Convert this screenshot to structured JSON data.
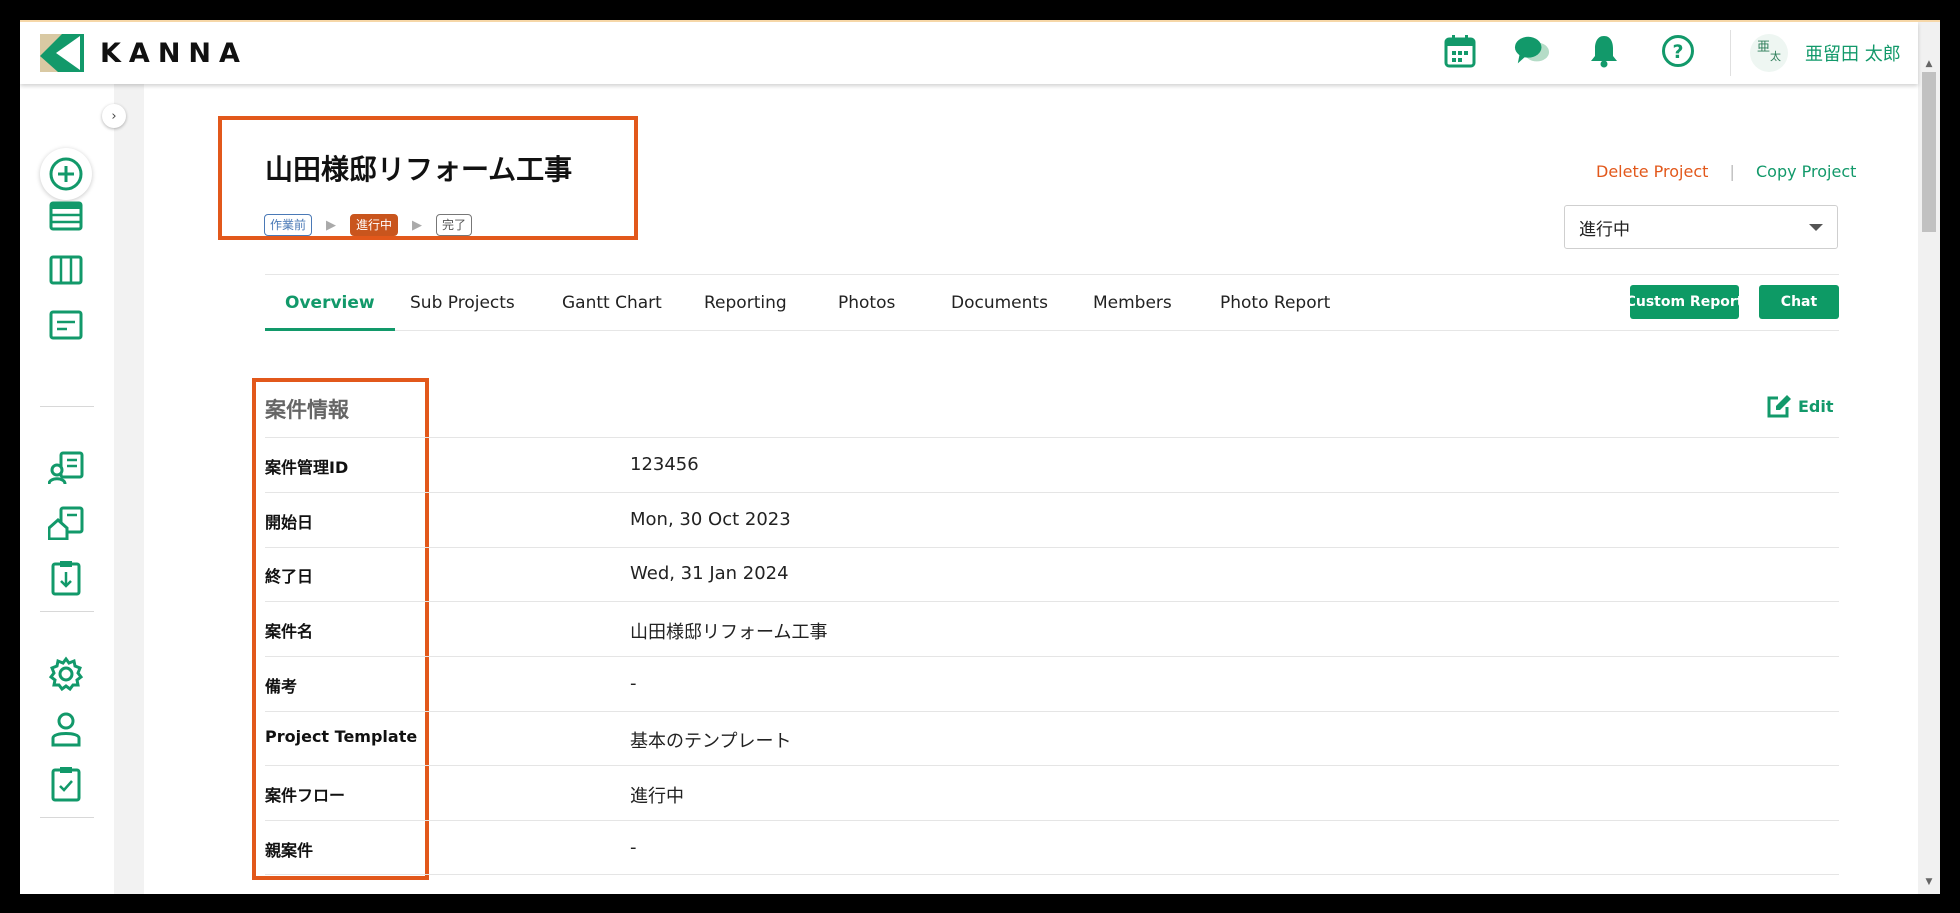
{
  "app": {
    "logo_text": "KANNA",
    "brand_color": "#12996a",
    "accent_color": "#e2581b"
  },
  "header": {
    "icons": [
      "calendar-icon",
      "chat-bubbles-icon",
      "bell-icon",
      "help-icon"
    ],
    "avatar_text_top": "亜",
    "avatar_text_bottom": "太",
    "user_name": "亜留田 太郎"
  },
  "sidebar": {
    "collapse_glyph": "›",
    "items": [
      "add-icon",
      "list-icon",
      "board-icon",
      "card-icon",
      "client-icon",
      "property-icon",
      "clipboard-download-icon",
      "gear-icon",
      "user-icon",
      "clipboard-check-icon"
    ]
  },
  "project": {
    "title": "山田様邸リフォーム工事",
    "flow": [
      {
        "label": "作業前",
        "state": "pre"
      },
      {
        "label": "進行中",
        "state": "current"
      },
      {
        "label": "完了",
        "state": "done"
      }
    ],
    "delete_label": "Delete Project",
    "copy_label": "Copy Project",
    "separator": "|",
    "status_value": "進行中"
  },
  "tabs": [
    "Overview",
    "Sub Projects",
    "Gantt Chart",
    "Reporting",
    "Photos",
    "Documents",
    "Members",
    "Photo Report"
  ],
  "active_tab": "Overview",
  "buttons": {
    "custom_report": "Custom Report",
    "chat": "Chat"
  },
  "info": {
    "section_title": "案件情報",
    "edit_label": "Edit",
    "rows": [
      {
        "label": "案件管理ID",
        "value": "123456"
      },
      {
        "label": "開始日",
        "value": "Mon, 30 Oct 2023"
      },
      {
        "label": "終了日",
        "value": "Wed, 31 Jan 2024"
      },
      {
        "label": "案件名",
        "value": "山田様邸リフォーム工事"
      },
      {
        "label": "備考",
        "value": "-"
      },
      {
        "label": "Project Template",
        "value": "基本のテンプレート"
      },
      {
        "label": "案件フロー",
        "value": "進行中"
      },
      {
        "label": "親案件",
        "value": "-"
      }
    ]
  }
}
